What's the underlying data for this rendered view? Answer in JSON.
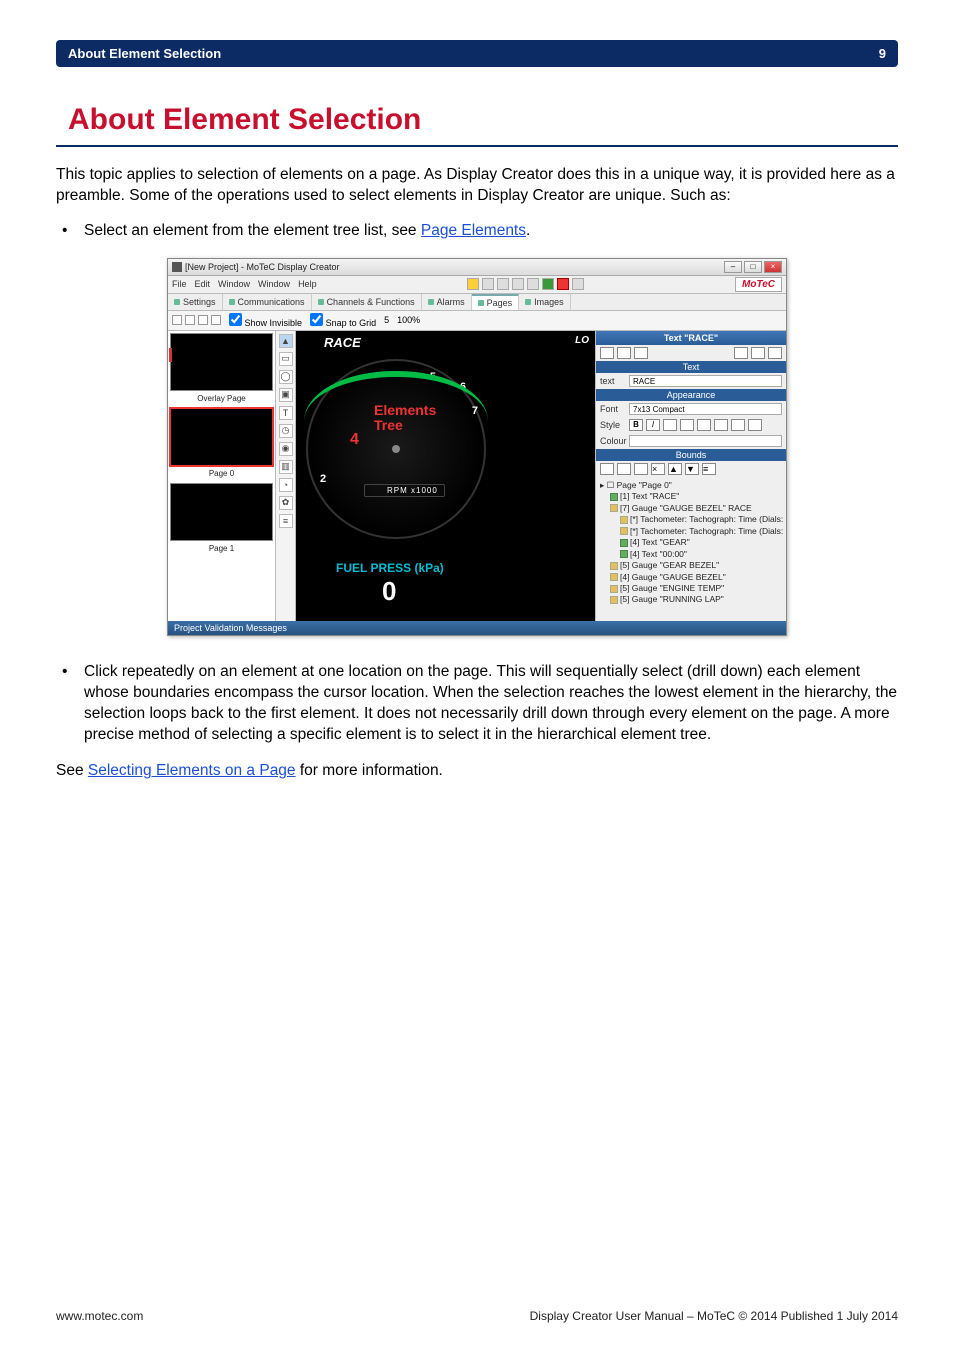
{
  "header": {
    "left": "About Element Selection",
    "right": "9"
  },
  "title": "About Element Selection",
  "intro": "This topic applies to selection of elements on a page. As Display Creator does this in a unique way, it is provided here as a preamble. Some of the operations used to select elements in Display Creator are unique. Such as:",
  "bullet1_prefix": "Select an element from the element tree list, see ",
  "bullet1_link": "Page Elements",
  "bullet1_suffix": ".",
  "bullet2": "Click repeatedly on an element at one location on the page. This will sequentially select (drill down) each element whose boundaries encompass the cursor location. When the selection reaches the lowest element in the hierarchy, the selection loops back to the first element. It does not necessarily drill down through every element on the page. A more precise method of selecting a specific element is to select it in the hierarchical element tree.",
  "see_prefix": "See ",
  "see_link": "Selecting Elements on a Page",
  "see_suffix": " for more information.",
  "footer": {
    "left": "www.motec.com",
    "right": "Display Creator User Manual – MoTeC © 2014 Published 1 July 2014"
  },
  "shot": {
    "title": "[New Project] - MoTeC Display Creator",
    "menus": [
      "File",
      "Edit",
      "Window",
      "Window",
      "Help"
    ],
    "brand": "MoTeC",
    "tabs": [
      "Settings",
      "Communications",
      "Channels & Functions",
      "Alarms",
      "Pages",
      "Images"
    ],
    "toolbar2": {
      "show_invisible": "Show Invisible",
      "snap": "Snap to Grid",
      "zoom_field": "5",
      "zoom_pct": "100%"
    },
    "left_thumbs": [
      "Overlay Page",
      "Page 0",
      "Page 1"
    ],
    "canvas": {
      "race": "RACE",
      "lo": "LO",
      "rpm_label": "RPM x1000",
      "fuel_label": "FUEL PRESS (kPa)",
      "fuel_value": "0",
      "dial_numbers": [
        "2",
        "4",
        "5",
        "6",
        "7"
      ],
      "callout_text_l1": "Elements",
      "callout_text_l2": "Tree",
      "callout_num": "4"
    },
    "right": {
      "panel1_title": "Text \"RACE\"",
      "panel_text_title": "Text",
      "text_label": "text",
      "text_value": "RACE",
      "appearance_title": "Appearance",
      "font_label": "Font",
      "font_value": "7x13 Compact",
      "style_label": "Style",
      "colour_label": "Colour",
      "bounds_title": "Bounds",
      "tree_title": "Page \"Page 0\"",
      "tree_items": [
        "[1] Text \"RACE\"",
        "[7] Gauge \"GAUGE BEZEL\"   RACE",
        "[*] Tachometer: Tachograph: Time (Dials: Dots: …Running)",
        "[*] Tachometer: Tachograph: Time (Dials: Dots: …Running)",
        "[4] Text \"GEAR\"",
        "[4] Text \"00:00\"",
        "[5] Gauge \"GEAR BEZEL\"",
        "[4] Gauge \"GAUGE BEZEL\"",
        "[5] Gauge \"ENGINE TEMP\"",
        "[5] Gauge \"RUNNING LAP\""
      ]
    },
    "status": "Project Validation Messages"
  }
}
